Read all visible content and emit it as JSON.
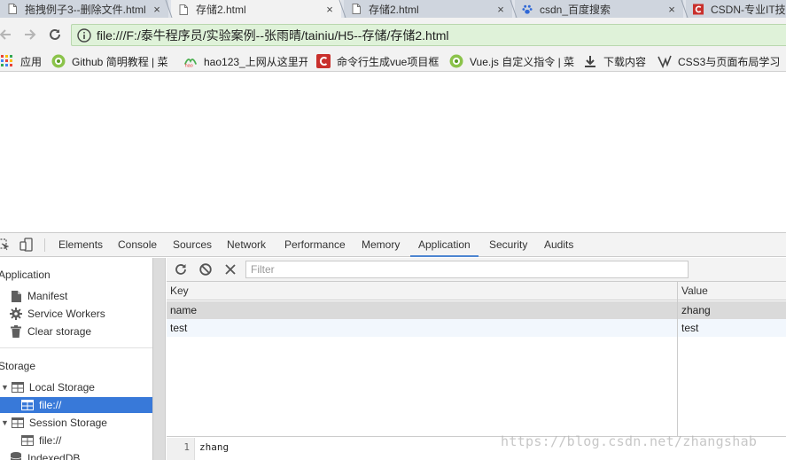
{
  "browser": {
    "tabs": [
      {
        "title": "拖拽例子3--删除文件.html",
        "close": "×",
        "favicon": "page-icon"
      },
      {
        "title": "存储2.html",
        "close": "×",
        "favicon": "page-icon",
        "active": true
      },
      {
        "title": "存储2.html",
        "close": "×",
        "favicon": "page-icon"
      },
      {
        "title": "csdn_百度搜索",
        "close": "×",
        "favicon": "baidu-paw-icon"
      },
      {
        "title": "CSDN-专业IT技",
        "favicon": "csdn-icon"
      }
    ],
    "address": "file:///F:/泰牛程序员/实验案例--张雨晴/tainiu/H5--存储/存储2.html",
    "bookmarks": [
      {
        "label": "应用",
        "icon": "apps-grid-icon"
      },
      {
        "label": "Github 简明教程 | 菜",
        "icon": "runoob-icon"
      },
      {
        "label": "hao123_上网从这里开",
        "icon": "hao123-icon"
      },
      {
        "label": "命令行生成vue项目框",
        "icon": "csdn-icon"
      },
      {
        "label": "Vue.js 自定义指令 | 菜",
        "icon": "runoob-icon"
      },
      {
        "label": "下载内容",
        "icon": "download-icon"
      },
      {
        "label": "CSS3与页面布局学习",
        "icon": "bookmark-v-icon"
      }
    ]
  },
  "devtools": {
    "tabs": [
      "Elements",
      "Console",
      "Sources",
      "Network",
      "Performance",
      "Memory",
      "Application",
      "Security",
      "Audits"
    ],
    "selected_tab": "Application",
    "sidebar": {
      "application_header": "Application",
      "application_items": [
        "Manifest",
        "Service Workers",
        "Clear storage"
      ],
      "storage_header": "Storage",
      "local_storage": {
        "label": "Local Storage",
        "children": [
          "file://"
        ]
      },
      "session_storage": {
        "label": "Session Storage",
        "children": [
          "file://"
        ]
      },
      "indexeddb": "IndexedDB"
    },
    "filter_placeholder": "Filter",
    "table": {
      "columns": [
        "Key",
        "Value"
      ],
      "rows": [
        {
          "key": "name",
          "value": "zhang"
        },
        {
          "key": "test",
          "value": "test"
        }
      ]
    },
    "preview": {
      "line_number": "1",
      "text": "zhang"
    }
  },
  "watermark": "https://blog.csdn.net/zhangshab",
  "colors": {
    "tabstrip": "#dfe3ea",
    "omnibox_secure": "#dff2d9",
    "accent": "#4d85d1",
    "selection": "#3879d9"
  }
}
